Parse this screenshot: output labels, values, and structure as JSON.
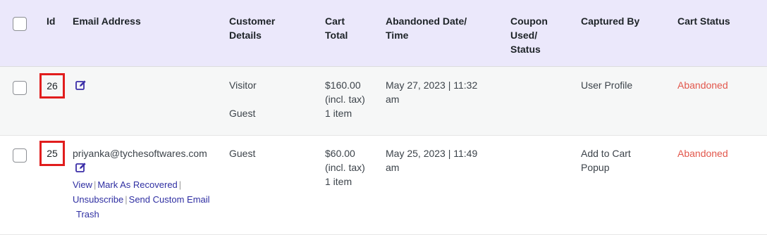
{
  "headers": {
    "id": "Id",
    "email": "Email Address",
    "customer_line1": "Customer",
    "customer_line2": "Details",
    "cart_line1": "Cart",
    "cart_line2": "Total",
    "abandoned_line1": "Abandoned Date/",
    "abandoned_line2": "Time",
    "coupon_line1": "Coupon",
    "coupon_line2": "Used/",
    "coupon_line3": "Status",
    "captured": "Captured By",
    "status": "Cart Status"
  },
  "rows": [
    {
      "id": "26",
      "email": "",
      "customer_line1": "Visitor",
      "customer_line2": "Guest",
      "cart_line1": "$160.00",
      "cart_line2": "(incl. tax)",
      "cart_line3": "1 item",
      "date_line1": "May 27, 2023 | 11:32",
      "date_line2": "am",
      "captured_line1": "User Profile",
      "captured_line2": "",
      "status": "Abandoned"
    },
    {
      "id": "25",
      "email": "priyanka@tychesoftwares.com",
      "customer_line1": "Guest",
      "cart_line1": "$60.00",
      "cart_line2": "(incl. tax)",
      "cart_line3": "1 item",
      "date_line1": "May 25, 2023 | 11:49",
      "date_line2": "am",
      "captured_line1": "Add to Cart",
      "captured_line2": "Popup",
      "status": "Abandoned",
      "actions": {
        "view": "View",
        "mark_recovered": "Mark As Recovered",
        "unsubscribe": "Unsubscribe",
        "send_email": "Send Custom Email",
        "trash": "Trash"
      }
    }
  ],
  "colors": {
    "header_bg": "#ebe8fb",
    "status": "#e2574c",
    "link": "#2f2fa2",
    "highlight_box": "#e11d1d"
  },
  "icons": {
    "edit": "edit-icon"
  }
}
